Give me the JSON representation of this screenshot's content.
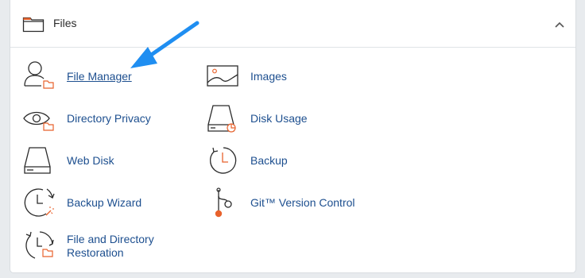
{
  "section": {
    "title": "Files",
    "collapse_icon": "chevron-up-icon"
  },
  "items": [
    {
      "id": "file-manager",
      "label": "File Manager",
      "icon": "user-folder-icon"
    },
    {
      "id": "images",
      "label": "Images",
      "icon": "image-icon"
    },
    {
      "id": "directory-privacy",
      "label": "Directory Privacy",
      "icon": "eye-folder-icon"
    },
    {
      "id": "disk-usage",
      "label": "Disk Usage",
      "icon": "disk-pie-icon"
    },
    {
      "id": "web-disk",
      "label": "Web Disk",
      "icon": "hard-drive-icon"
    },
    {
      "id": "backup",
      "label": "Backup",
      "icon": "clock-restore-icon"
    },
    {
      "id": "backup-wizard",
      "label": "Backup Wizard",
      "icon": "clock-wand-icon"
    },
    {
      "id": "git-version-control",
      "label": "Git™ Version Control",
      "icon": "git-branch-icon"
    },
    {
      "id": "file-directory-restoration",
      "label_line1": "File and Directory",
      "label_line2": "Restoration",
      "icon": "clock-folder-icon"
    }
  ],
  "colors": {
    "link": "#1d4f8f",
    "accent_orange": "#e8622c",
    "arrow_blue": "#1f8ef1",
    "icon_stroke": "#2b2b2b"
  }
}
